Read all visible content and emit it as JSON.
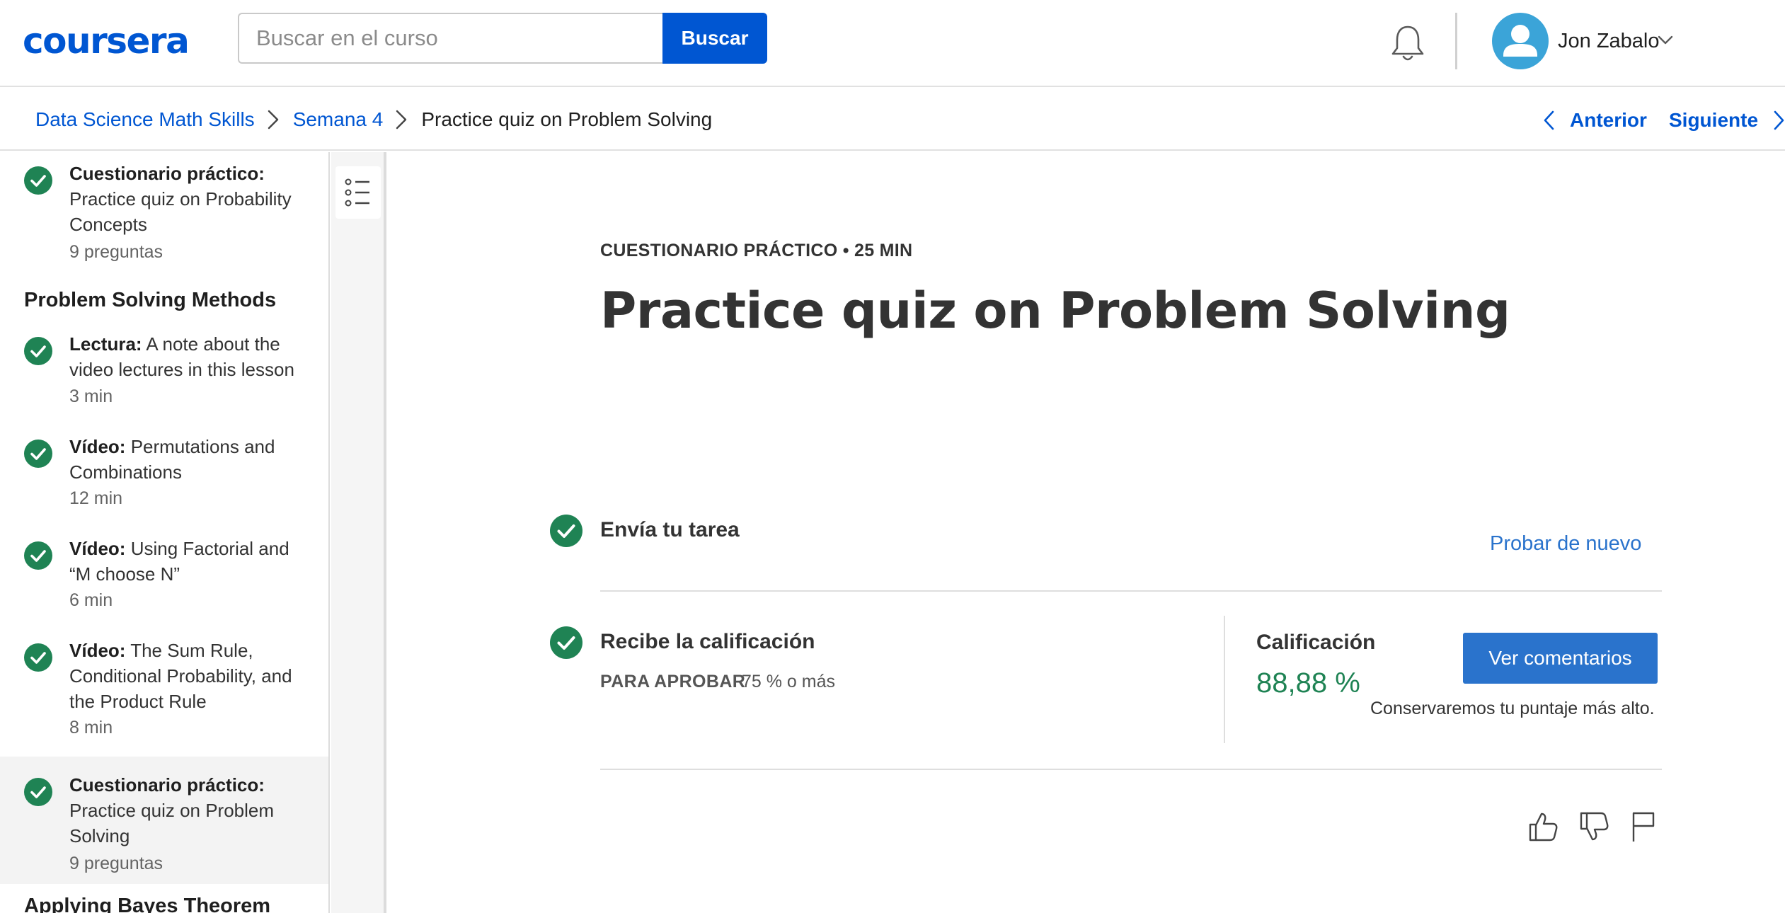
{
  "header": {
    "logo": "coursera",
    "search": {
      "placeholder": "Buscar en el curso",
      "value": "",
      "button_label": "Buscar"
    },
    "user": {
      "name": "Jon Zabalo"
    },
    "icons": {
      "notifications": "bell-icon",
      "avatar": "user-avatar-icon",
      "menu": "chevron-down-icon"
    }
  },
  "breadcrumb": {
    "items": [
      "Data Science Math Skills",
      "Semana 4",
      "Practice quiz on Problem Solving"
    ],
    "prev_label": "Anterior",
    "next_label": "Siguiente"
  },
  "sidebar": {
    "item_probability": {
      "type": "Cuestionario práctico:",
      "title": "Practice quiz on Probability Concepts",
      "meta": "9 preguntas"
    },
    "section_problem_solving": "Problem Solving Methods",
    "item_note": {
      "type": "Lectura:",
      "title": "A note about the video lectures in this lesson",
      "meta": "3 min"
    },
    "item_permutations": {
      "type": "Vídeo:",
      "title": "Permutations and Combinations",
      "meta": "12 min"
    },
    "item_factorial": {
      "type": "Vídeo:",
      "title": "Using Factorial and “M choose N”",
      "meta": "6 min"
    },
    "item_sum_rule": {
      "type": "Vídeo:",
      "title": "The Sum Rule, Conditional Probability, and the Product Rule",
      "meta": "8 min"
    },
    "item_problem_quiz": {
      "type": "Cuestionario práctico:",
      "title": "Practice quiz on Problem Solving",
      "meta": "9 preguntas"
    },
    "section_bayes": "Applying Bayes Theorem"
  },
  "main": {
    "kicker": "CUESTIONARIO PRÁCTICO • 25 MIN",
    "title": "Practice quiz on Problem Solving",
    "submit_step": {
      "title": "Envía tu tarea",
      "retry_label": "Probar de nuevo"
    },
    "grade_step": {
      "title": "Recibe la calificación",
      "pass_label": "PARA APROBAR",
      "pass_value": "75 % o más",
      "grade_label": "Calificación",
      "grade_value": "88,88 %",
      "feedback_button": "Ver comentarios",
      "keep_note": "Conservaremos tu puntaje más alto."
    }
  },
  "colors": {
    "brand": "#0056d2",
    "link": "#2a73cc",
    "success": "#1f8354"
  }
}
